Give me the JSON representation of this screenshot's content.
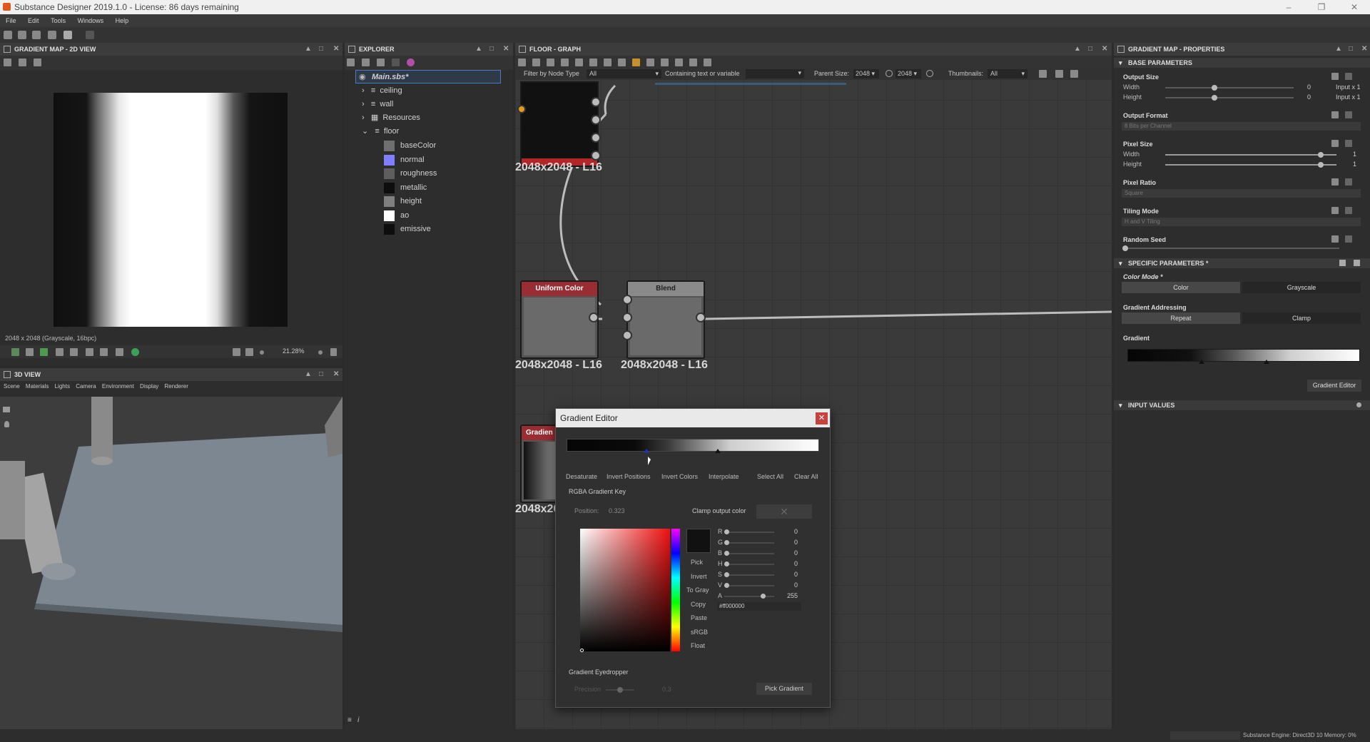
{
  "window": {
    "title": "Substance Designer 2019.1.0 - License: 86 days remaining"
  },
  "menu": [
    "File",
    "Edit",
    "Tools",
    "Windows",
    "Help"
  ],
  "view2d": {
    "header": "Gradient Map - 2D VIEW",
    "status": "2048 x 2048 (Grayscale, 16bpc)",
    "zoom": "21.28%"
  },
  "view3d": {
    "header": "3D VIEW",
    "menu": [
      "Scene",
      "Materials",
      "Lights",
      "Camera",
      "Environment",
      "Display",
      "Renderer"
    ]
  },
  "explorer": {
    "header": "EXPLORER",
    "root": "Main.sbs*",
    "items": [
      "ceiling",
      "wall",
      "Resources",
      "floor"
    ],
    "outputs": [
      {
        "label": "baseColor",
        "color": "#6f6f6f"
      },
      {
        "label": "normal",
        "color": "#7f7fff"
      },
      {
        "label": "roughness",
        "color": "#5e5e5e"
      },
      {
        "label": "metallic",
        "color": "#0d0d0d"
      },
      {
        "label": "height",
        "color": "#7f7f7f"
      },
      {
        "label": "ao",
        "color": "#ffffff"
      },
      {
        "label": "emissive",
        "color": "#0d0d0d"
      }
    ]
  },
  "graph": {
    "header": "floor - GRAPH",
    "filter_label": "Filter by Node Type",
    "filter_value": "All",
    "contain_label": "Containing text or variable",
    "parent_label": "Parent Size:",
    "parent_w": "2048",
    "parent_h": "2048",
    "thumb_label": "Thumbnails:",
    "thumb_value": "All",
    "nodes": {
      "top_res": "2048x2048 - L16",
      "uniform_title": "Uniform Color",
      "uniform_res": "2048x2048 - L16",
      "blend_title": "Blend",
      "blend_res": "2048x2048 - L16",
      "gradient_title": "Gradien",
      "gradient_res": "2048x20"
    }
  },
  "properties": {
    "header": "Gradient Map - PROPERTIES",
    "base_section": "BASE PARAMETERS",
    "output_size": "Output Size",
    "width": "Width",
    "height": "Height",
    "os_w_val": "0",
    "os_h_val": "0",
    "os_w_rel": "Input x 1",
    "os_h_rel": "Input x 1",
    "output_format": "Output Format",
    "output_format_val": "8 Bits per Channel",
    "pixel_size": "Pixel Size",
    "ps_w_val": "1",
    "ps_h_val": "1",
    "pixel_ratio": "Pixel Ratio",
    "pixel_ratio_val": "Square",
    "tiling_mode": "Tiling Mode",
    "tiling_mode_val": "H and V Tiling",
    "random_seed": "Random Seed",
    "specific_section": "SPECIFIC PARAMETERS *",
    "color_mode": "Color Mode *",
    "cm_color": "Color",
    "cm_gray": "Grayscale",
    "addressing": "Gradient Addressing",
    "repeat": "Repeat",
    "clamp": "Clamp",
    "gradient": "Gradient",
    "gradient_editor_btn": "Gradient Editor",
    "input_section": "INPUT VALUES"
  },
  "dialog": {
    "title": "Gradient Editor",
    "actions": [
      "Desaturate",
      "Invert Positions",
      "Invert Colors",
      "Interpolate",
      "Select All",
      "Clear All"
    ],
    "rgba_key": "RGBA Gradient Key",
    "position_label": "Position:",
    "position_value": "0.323",
    "clamp_label": "Clamp output color",
    "tools": [
      "Pick",
      "Invert",
      "To Gray",
      "Copy",
      "Paste",
      "sRGB",
      "Float"
    ],
    "channels": [
      {
        "name": "R",
        "value": "0"
      },
      {
        "name": "G",
        "value": "0"
      },
      {
        "name": "B",
        "value": "0"
      },
      {
        "name": "H",
        "value": "0"
      },
      {
        "name": "S",
        "value": "0"
      },
      {
        "name": "V",
        "value": "0"
      },
      {
        "name": "A",
        "value": "255"
      }
    ],
    "hex": "#ff000000",
    "eyedropper": "Gradient Eyedropper",
    "precision_label": "Precision",
    "precision_value": "0.3",
    "pick_gradient": "Pick Gradient"
  },
  "statusbar": {
    "engine": "Substance Engine: Direct3D 10  Memory: 0%"
  }
}
